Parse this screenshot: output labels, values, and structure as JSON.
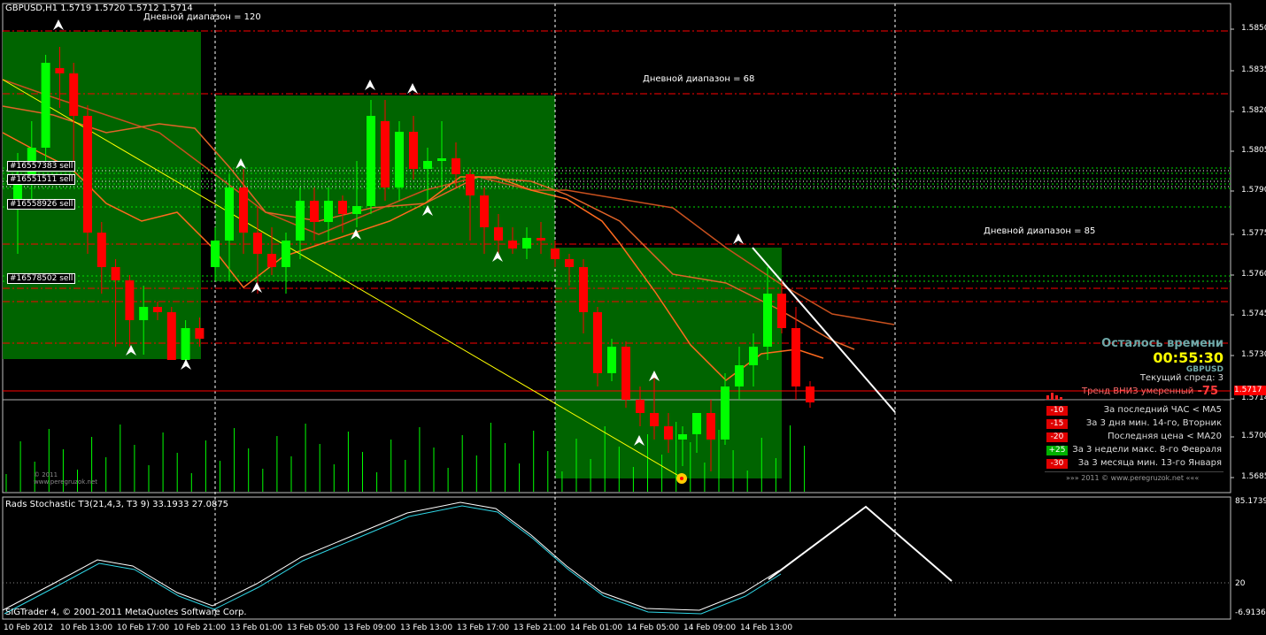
{
  "chart_header": "GBPUSD,H1  1.5719 1.5720 1.5712 1.5714",
  "range_labels": [
    "Дневной диапазон = 120",
    "Дневной диапазон = 68",
    "Дневной диапазон = 85"
  ],
  "order_labels": [
    "#16557383 sell",
    "#16551511 sell",
    "#16558926 sell",
    "#16578502 sell"
  ],
  "mini_logo": "© 2011 www.peregruzok.net",
  "price_axis": {
    "ticks": [
      "1.5850",
      "1.5835",
      "1.5820",
      "1.5805",
      "1.5790",
      "1.5775",
      "1.5760",
      "1.5745",
      "1.5730",
      "1.5714",
      "1.5700",
      "1.5685"
    ],
    "bid_badge": "1.5717"
  },
  "time_axis": [
    "10 Feb 2012",
    "10 Feb 13:00",
    "10 Feb 17:00",
    "10 Feb 21:00",
    "13 Feb 01:00",
    "13 Feb 05:00",
    "13 Feb 09:00",
    "13 Feb 13:00",
    "13 Feb 17:00",
    "13 Feb 21:00",
    "14 Feb 01:00",
    "14 Feb 05:00",
    "14 Feb 09:00",
    "14 Feb 13:00"
  ],
  "info_panel": {
    "remaining_label": "Осталось времени",
    "timer": "00:55:30",
    "symbol": "GBPUSD",
    "spread": "Текущий спред: 3",
    "trend_label": "Тренд ВНИЗ умеренный",
    "trend_value": "-75",
    "rows": [
      {
        "value": "-10",
        "text": "За последний ЧАС < MA5",
        "color": "#e00000"
      },
      {
        "value": "-15",
        "text": "За 3 дня мин. 14-го, Вторник",
        "color": "#e00000"
      },
      {
        "value": "-20",
        "text": "Последняя цена < MA20",
        "color": "#e00000"
      },
      {
        "value": "+25",
        "text": "За 3 недели макс. 8-го Февраля",
        "color": "#00b000"
      },
      {
        "value": "-30",
        "text": "За 3 месяца мин. 13-го Января",
        "color": "#e00000"
      }
    ],
    "footer": "»»»    2011  ©  www.peregruzok.net    «««"
  },
  "indicator": {
    "title": "Rads Stochastic T3(21,4,3, T3 9) 33.1933 27.0875",
    "ticks": [
      "85.1739",
      "20",
      "-6.9136"
    ],
    "copyright": "SIGTrader 4, © 2001-2011 MetaQuotes Software Corp."
  },
  "colors": {
    "bull": "#00ff00",
    "bear": "#ff0000",
    "box": "#006400",
    "accent": "#ffff00"
  },
  "chart_data": {
    "type": "candlestick",
    "symbol": "GBPUSD",
    "timeframe": "H1",
    "ylim": [
      1.568,
      1.586
    ],
    "series": [
      {
        "name": "GBPUSD",
        "candles": [
          [
            1.579,
            1.5808,
            1.577,
            1.58
          ],
          [
            1.58,
            1.582,
            1.579,
            1.581
          ],
          [
            1.581,
            1.5845,
            1.5805,
            1.5842
          ],
          [
            1.584,
            1.5848,
            1.5825,
            1.5838
          ],
          [
            1.5838,
            1.5842,
            1.5805,
            1.5822
          ],
          [
            1.5822,
            1.5826,
            1.577,
            1.5778
          ],
          [
            1.5778,
            1.5782,
            1.5755,
            1.5765
          ],
          [
            1.5765,
            1.5768,
            1.5735,
            1.576
          ],
          [
            1.576,
            1.5762,
            1.5735,
            1.5745
          ],
          [
            1.5745,
            1.5758,
            1.5732,
            1.575
          ],
          [
            1.575,
            1.5752,
            1.5745,
            1.5748
          ],
          [
            1.5748,
            1.575,
            1.5735,
            1.573
          ],
          [
            1.573,
            1.5745,
            1.5728,
            1.5742
          ],
          [
            1.5742,
            1.5746,
            1.5735,
            1.5738
          ],
          [
            1.5765,
            1.578,
            1.576,
            1.5775
          ],
          [
            1.5775,
            1.58,
            1.576,
            1.5795
          ],
          [
            1.5795,
            1.5802,
            1.577,
            1.5778
          ],
          [
            1.5778,
            1.5788,
            1.5755,
            1.577
          ],
          [
            1.577,
            1.578,
            1.5762,
            1.5765
          ],
          [
            1.5765,
            1.5778,
            1.5755,
            1.5775
          ],
          [
            1.5775,
            1.5795,
            1.5768,
            1.579
          ],
          [
            1.579,
            1.5795,
            1.5775,
            1.5782
          ],
          [
            1.5782,
            1.5795,
            1.5775,
            1.579
          ],
          [
            1.579,
            1.5792,
            1.5778,
            1.5785
          ],
          [
            1.5785,
            1.5805,
            1.578,
            1.5788
          ],
          [
            1.5788,
            1.5828,
            1.5785,
            1.5822
          ],
          [
            1.582,
            1.5828,
            1.579,
            1.5795
          ],
          [
            1.5795,
            1.582,
            1.579,
            1.5816
          ],
          [
            1.5816,
            1.5822,
            1.5798,
            1.5802
          ],
          [
            1.5802,
            1.581,
            1.579,
            1.5805
          ],
          [
            1.5805,
            1.582,
            1.5795,
            1.5806
          ],
          [
            1.5806,
            1.5812,
            1.5795,
            1.58
          ],
          [
            1.58,
            1.5802,
            1.5775,
            1.5792
          ],
          [
            1.5792,
            1.5795,
            1.577,
            1.578
          ],
          [
            1.578,
            1.5785,
            1.577,
            1.5775
          ],
          [
            1.5775,
            1.578,
            1.577,
            1.5772
          ],
          [
            1.5772,
            1.578,
            1.5768,
            1.5776
          ],
          [
            1.5776,
            1.5782,
            1.577,
            1.5775
          ],
          [
            1.5772,
            1.5775,
            1.5765,
            1.5768
          ],
          [
            1.5768,
            1.577,
            1.5758,
            1.5765
          ],
          [
            1.5765,
            1.5768,
            1.574,
            1.5748
          ],
          [
            1.5748,
            1.575,
            1.572,
            1.5725
          ],
          [
            1.5725,
            1.5738,
            1.5722,
            1.5735
          ],
          [
            1.5735,
            1.5737,
            1.5712,
            1.5715
          ],
          [
            1.5715,
            1.572,
            1.5705,
            1.571
          ],
          [
            1.571,
            1.5725,
            1.57,
            1.5705
          ],
          [
            1.5705,
            1.571,
            1.5695,
            1.57
          ],
          [
            1.57,
            1.5705,
            1.569,
            1.5702
          ],
          [
            1.5702,
            1.571,
            1.5695,
            1.571
          ],
          [
            1.571,
            1.5715,
            1.5688,
            1.57
          ],
          [
            1.57,
            1.5725,
            1.5698,
            1.572
          ],
          [
            1.572,
            1.5735,
            1.5715,
            1.5728
          ],
          [
            1.5728,
            1.574,
            1.572,
            1.5735
          ],
          [
            1.5735,
            1.5765,
            1.573,
            1.5755
          ],
          [
            1.5755,
            1.576,
            1.574,
            1.5742
          ],
          [
            1.5742,
            1.575,
            1.5715,
            1.572
          ],
          [
            1.572,
            1.5722,
            1.5712,
            1.5714
          ]
        ]
      }
    ]
  }
}
